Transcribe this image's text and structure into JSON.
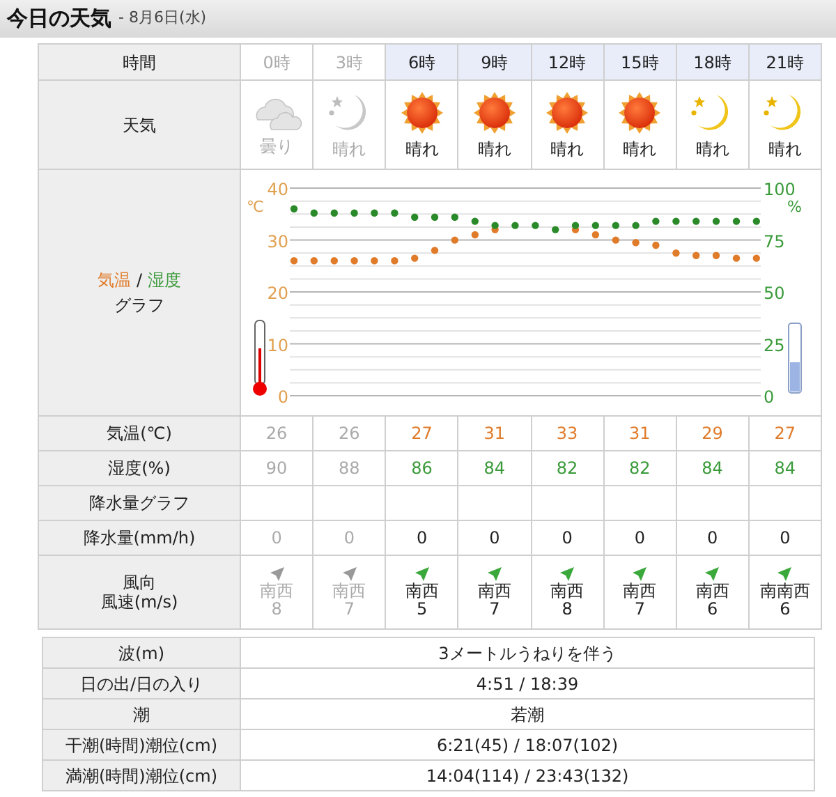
{
  "header": {
    "title": "今日の天気",
    "date": "- 8月6日(水)"
  },
  "forecast": {
    "labels": {
      "time": "時間",
      "weather": "天気",
      "temp": "気温(℃)",
      "humidity": "湿度(%)",
      "rain_graph": "降水量グラフ",
      "rain": "降水量(mm/h)",
      "wind": [
        "風向",
        "風速(m/s)"
      ]
    },
    "graph_label": {
      "separator": "/",
      "suffix": "グラフ"
    },
    "columns": [
      {
        "time": "0時",
        "past": true,
        "weather": {
          "kind": "cloudy",
          "label": "曇り"
        },
        "temp": "26",
        "humidity": "90",
        "rain": "0",
        "wind_dir": "南西",
        "wind_speed": "8"
      },
      {
        "time": "3時",
        "past": true,
        "weather": {
          "kind": "night",
          "label": "晴れ"
        },
        "temp": "26",
        "humidity": "88",
        "rain": "0",
        "wind_dir": "南西",
        "wind_speed": "7"
      },
      {
        "time": "6時",
        "past": false,
        "weather": {
          "kind": "sunny",
          "label": "晴れ"
        },
        "temp": "27",
        "humidity": "86",
        "rain": "0",
        "wind_dir": "南西",
        "wind_speed": "5"
      },
      {
        "time": "9時",
        "past": false,
        "weather": {
          "kind": "sunny",
          "label": "晴れ"
        },
        "temp": "31",
        "humidity": "84",
        "rain": "0",
        "wind_dir": "南西",
        "wind_speed": "7"
      },
      {
        "time": "12時",
        "past": false,
        "weather": {
          "kind": "sunny",
          "label": "晴れ"
        },
        "temp": "33",
        "humidity": "82",
        "rain": "0",
        "wind_dir": "南西",
        "wind_speed": "8"
      },
      {
        "time": "15時",
        "past": false,
        "weather": {
          "kind": "sunny",
          "label": "晴れ"
        },
        "temp": "31",
        "humidity": "82",
        "rain": "0",
        "wind_dir": "南西",
        "wind_speed": "7"
      },
      {
        "time": "18時",
        "past": false,
        "weather": {
          "kind": "night",
          "label": "晴れ"
        },
        "temp": "29",
        "humidity": "84",
        "rain": "0",
        "wind_dir": "南西",
        "wind_speed": "6"
      },
      {
        "time": "21時",
        "past": false,
        "weather": {
          "kind": "night",
          "label": "晴れ"
        },
        "temp": "27",
        "humidity": "84",
        "rain": "0",
        "wind_dir": "南南西",
        "wind_speed": "6"
      }
    ],
    "chart_data": {
      "type": "scatter",
      "grid": true,
      "ylabel": "℃",
      "y2label": "%",
      "ylim": [
        0,
        40
      ],
      "yticks": [
        0,
        10,
        20,
        30,
        40
      ],
      "y2lim": [
        0,
        100
      ],
      "y2ticks": [
        0,
        25,
        50,
        75,
        100
      ],
      "series": [
        {
          "name": "気温",
          "color": "#e07b2a",
          "values": [
            26,
            26,
            26,
            26,
            26,
            26,
            26.5,
            28,
            30,
            31,
            32,
            null,
            null,
            null,
            32,
            31,
            30,
            29.5,
            29,
            27.5,
            27,
            27,
            26.5,
            26.5
          ]
        },
        {
          "name": "湿度",
          "color": "#2a8a2a",
          "axis": "y2",
          "values": [
            90,
            88,
            88,
            88,
            88,
            88,
            86,
            86,
            86,
            84,
            82,
            82,
            82,
            80,
            82,
            82,
            82,
            82,
            84,
            84,
            84,
            84,
            84,
            84
          ]
        }
      ]
    }
  },
  "details": [
    {
      "label": "波(m)",
      "value": "3メートルうねりを伴う"
    },
    {
      "label": "日の出/日の入り",
      "value": "4:51 / 18:39"
    },
    {
      "label": "潮",
      "value": "若潮"
    },
    {
      "label": "干潮(時間)潮位(cm)",
      "value": "6:21(45) / 18:07(102)"
    },
    {
      "label": "満潮(時間)潮位(cm)",
      "value": "14:04(114) / 23:43(132)"
    }
  ]
}
